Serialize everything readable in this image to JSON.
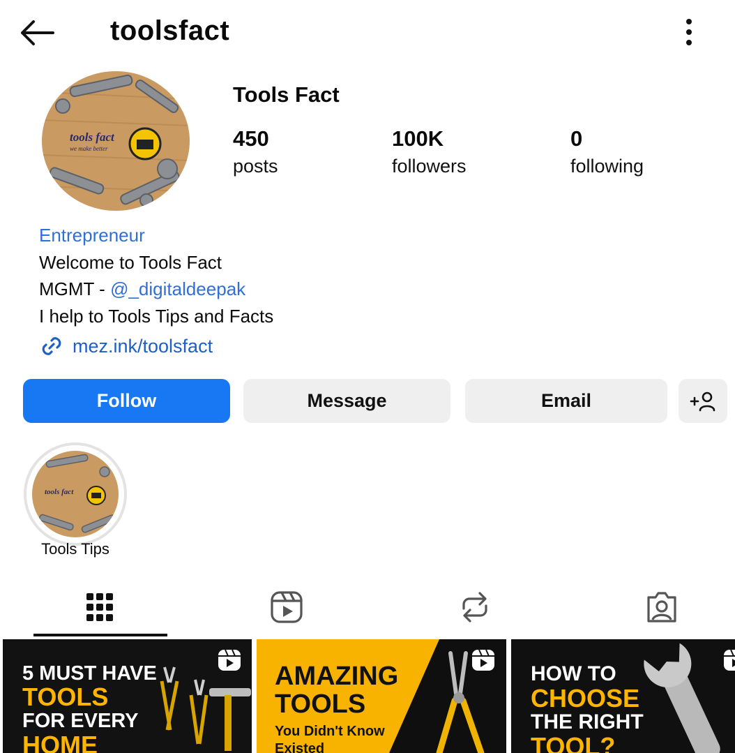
{
  "header": {
    "username": "toolsfact",
    "back_icon": "arrow-left-icon",
    "menu_icon": "more-vertical-icon"
  },
  "avatar_logo": {
    "line1": "tools fact",
    "line2": "we make better"
  },
  "profile": {
    "display_name": "Tools Fact",
    "stats": {
      "posts": {
        "value": "450",
        "label": "posts"
      },
      "followers": {
        "value": "100K",
        "label": "followers"
      },
      "following": {
        "value": "0",
        "label": "following"
      }
    }
  },
  "bio": {
    "category": "Entrepreneur",
    "line1": "Welcome to Tools Fact",
    "line2_prefix": "MGMT - ",
    "line2_mention": "@_digitaldeepak",
    "line3": "I help to Tools Tips and Facts",
    "link": "mez.ink/toolsfact"
  },
  "actions": {
    "follow": "Follow",
    "message": "Message",
    "email": "Email",
    "add_user": "+"
  },
  "highlights": [
    {
      "label": "Tools Tips"
    }
  ],
  "tabs": [
    {
      "name": "posts-grid",
      "icon": "grid-icon"
    },
    {
      "name": "reels",
      "icon": "reels-icon"
    },
    {
      "name": "reposts",
      "icon": "repost-icon"
    },
    {
      "name": "tagged",
      "icon": "tagged-user-icon"
    }
  ],
  "posts": [
    {
      "line1": "5 MUST HAVE",
      "line2": "TOOLS",
      "line3": "FOR EVERY",
      "line4": "HOME"
    },
    {
      "line1": "AMAZING",
      "line2": "TOOLS",
      "line3": "You Didn't Know",
      "line4": "Existed"
    },
    {
      "line1": "HOW TO",
      "line2": "CHOOSE",
      "line3": "THE RIGHT",
      "line4": "TOOL?"
    }
  ],
  "colors": {
    "accent_blue": "#1877f2",
    "link_blue": "#2f6fd6",
    "button_gray": "#efefef",
    "post_yellow": "#f7b300"
  }
}
